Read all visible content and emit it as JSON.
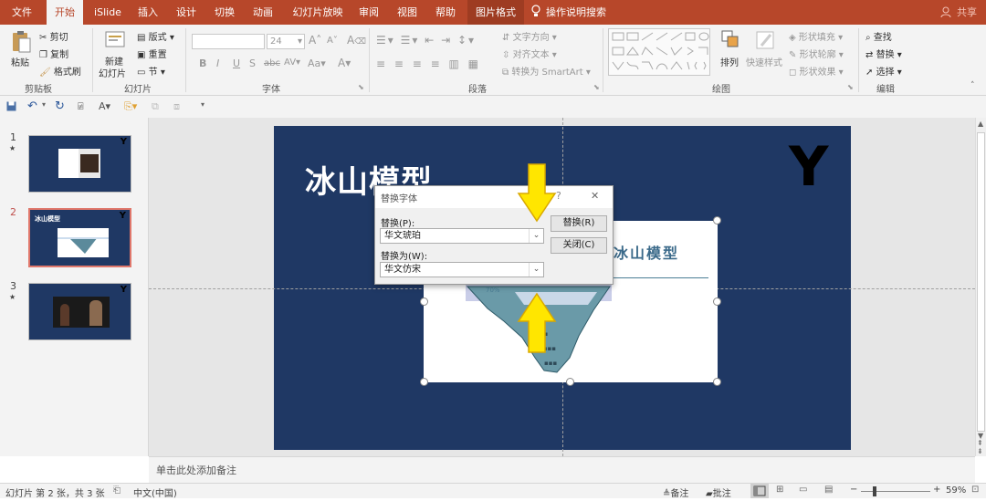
{
  "tabs": [
    "文件",
    "开始",
    "iSlide",
    "插入",
    "设计",
    "切换",
    "动画",
    "幻灯片放映",
    "审阅",
    "视图",
    "帮助",
    "图片格式"
  ],
  "tell_me": "操作说明搜索",
  "share": "共享",
  "clipboard": {
    "paste": "粘贴",
    "cut": "剪切",
    "copy": "复制",
    "format_painter": "格式刷",
    "group": "剪贴板"
  },
  "slides_group": {
    "new_slide_line1": "新建",
    "new_slide_line2": "幻灯片",
    "layout": "版式",
    "reset": "重置",
    "section": "节",
    "group": "幻灯片"
  },
  "font_group": {
    "size": "24",
    "group": "字体",
    "bold": "B",
    "italic": "I",
    "underline": "U",
    "shadow": "S",
    "strike": "abc",
    "spacing": "AV",
    "case": "Aa",
    "grow": "A",
    "shrink": "A",
    "clear": "A",
    "color": "A"
  },
  "paragraph_group": {
    "text_direction": "文字方向",
    "align_text": "对齐文本",
    "convert_smartart": "转换为 SmartArt",
    "group": "段落"
  },
  "drawing_group": {
    "arrange": "排列",
    "quick_styles": "快速样式",
    "shape_fill": "形状填充",
    "shape_outline": "形状轮廓",
    "shape_effects": "形状效果",
    "group": "绘图"
  },
  "editing_group": {
    "find": "查找",
    "replace": "替换",
    "select": "选择",
    "group": "编辑"
  },
  "thumbnails": [
    {
      "num": "1",
      "star": "★"
    },
    {
      "num": "2",
      "star": ""
    },
    {
      "num": "3",
      "star": "★"
    }
  ],
  "slide": {
    "title": "冰山模型",
    "corner": "Y"
  },
  "picture": {
    "title": "冰山模型",
    "pct": "70%"
  },
  "dialog": {
    "title": "替换字体",
    "help": "?",
    "close": "✕",
    "replace_label": "替换(P):",
    "replace_value": "华文琥珀",
    "with_label": "替换为(W):",
    "with_value": "华文仿宋",
    "replace_button": "替换(R)",
    "close_button": "关闭(C)"
  },
  "notes_placeholder": "单击此处添加备注",
  "status": {
    "slide_info": "幻灯片 第 2 张，共 3 张",
    "language": "中文(中国)",
    "notes": "备注",
    "comments": "批注",
    "zoom": "59%"
  },
  "colors": {
    "accent": "#b7472a",
    "slide_bg": "#1f3864",
    "arrow": "#ffe600"
  }
}
